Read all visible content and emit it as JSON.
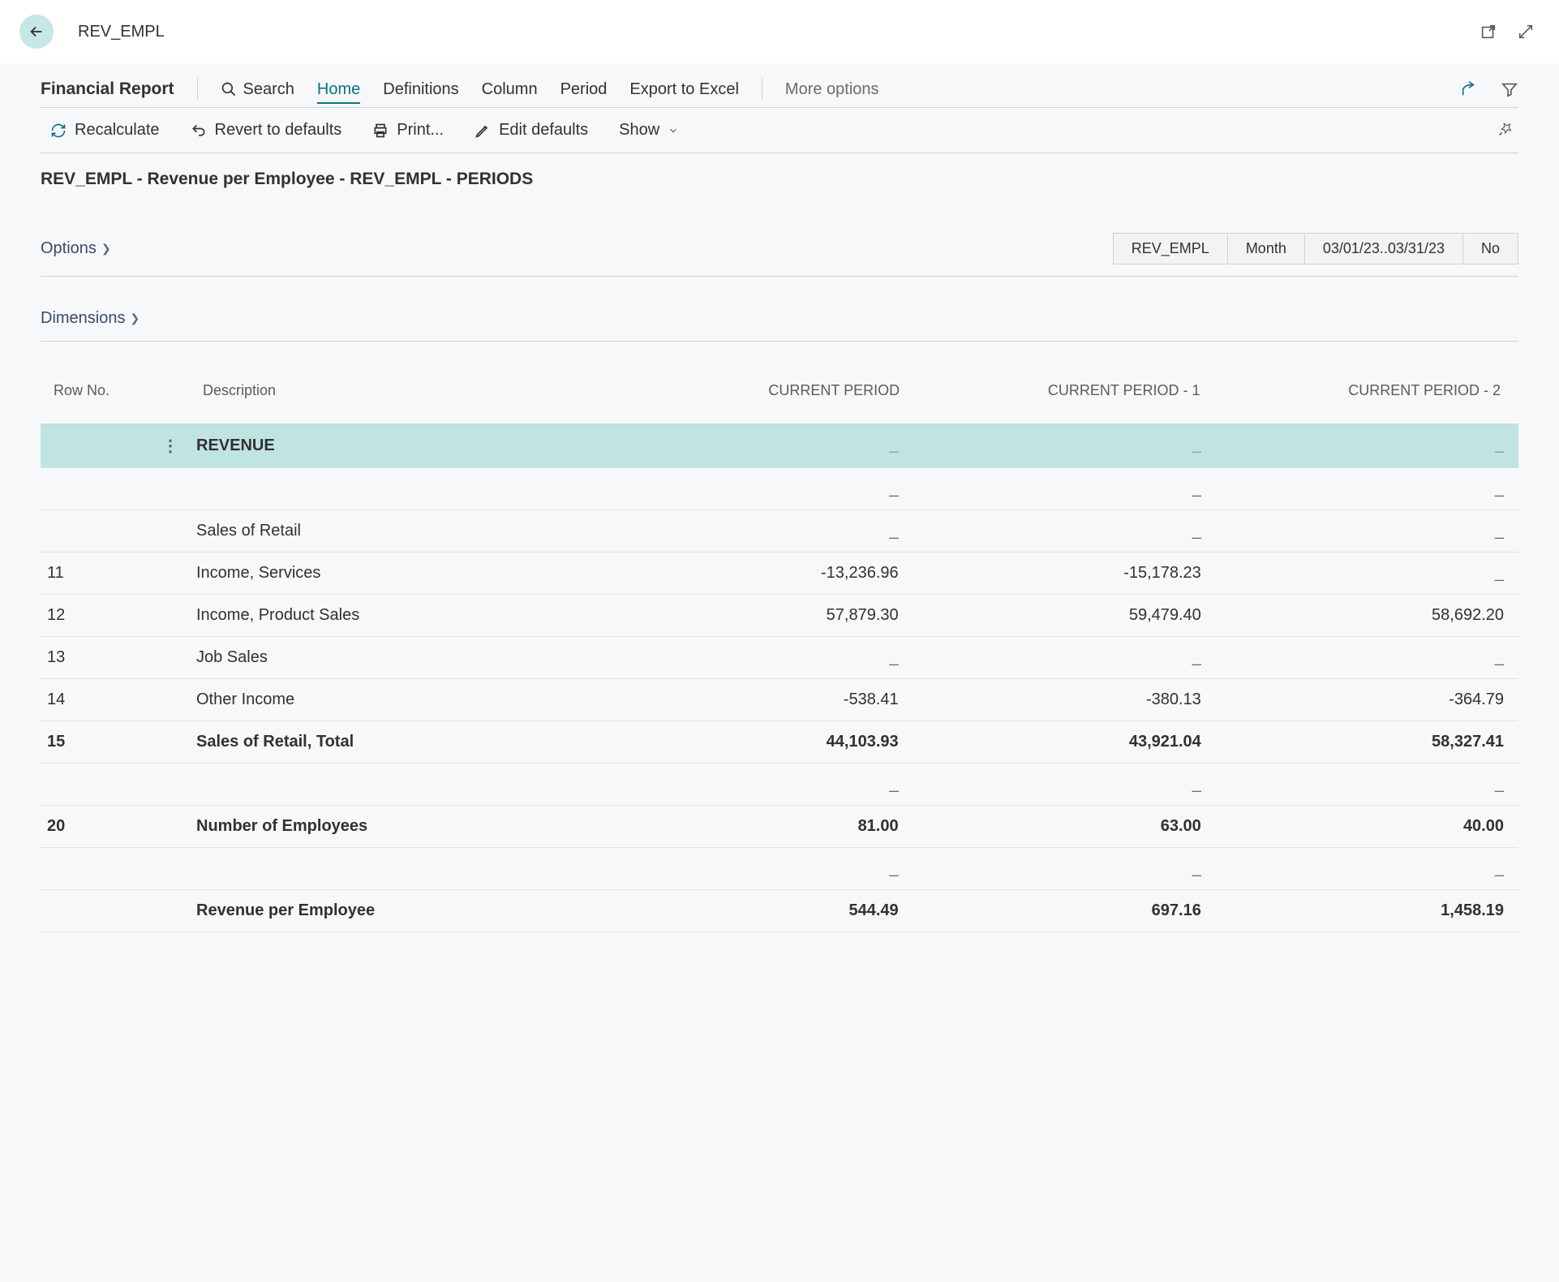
{
  "header": {
    "title": "REV_EMPL"
  },
  "ribbon": {
    "title": "Financial Report",
    "search": "Search",
    "home": "Home",
    "definitions": "Definitions",
    "column": "Column",
    "period": "Period",
    "export_excel": "Export to Excel",
    "more_options": "More options"
  },
  "toolbar": {
    "recalculate": "Recalculate",
    "revert": "Revert to defaults",
    "print": "Print...",
    "edit_defaults": "Edit defaults",
    "show": "Show"
  },
  "subtitle": "REV_EMPL - Revenue per Employee - REV_EMPL - PERIODS",
  "options_panel": {
    "label": "Options",
    "pills": [
      "REV_EMPL",
      "Month",
      "03/01/23..03/31/23",
      "No"
    ]
  },
  "dimensions_panel": {
    "label": "Dimensions"
  },
  "table": {
    "headers": {
      "row_no": "Row No.",
      "description": "Description",
      "col1": "CURRENT PERIOD",
      "col2": "CURRENT PERIOD - 1",
      "col3": "CURRENT PERIOD - 2"
    },
    "rows": [
      {
        "row_no": "",
        "desc": "REVENUE",
        "c1": "_",
        "c2": "_",
        "c3": "_",
        "bold": true,
        "hl": true,
        "menu": true
      },
      {
        "row_no": "",
        "desc": "",
        "c1": "_",
        "c2": "_",
        "c3": "_"
      },
      {
        "row_no": "",
        "desc": "Sales of Retail",
        "c1": "_",
        "c2": "_",
        "c3": "_"
      },
      {
        "row_no": "11",
        "desc": "Income, Services",
        "c1": "-13,236.96",
        "c2": "-15,178.23",
        "c3": "_"
      },
      {
        "row_no": "12",
        "desc": "Income, Product Sales",
        "c1": "57,879.30",
        "c2": "59,479.40",
        "c3": "58,692.20"
      },
      {
        "row_no": "13",
        "desc": "Job Sales",
        "c1": "_",
        "c2": "_",
        "c3": "_"
      },
      {
        "row_no": "14",
        "desc": "Other Income",
        "c1": "-538.41",
        "c2": "-380.13",
        "c3": "-364.79"
      },
      {
        "row_no": "15",
        "desc": "Sales of Retail, Total",
        "c1": "44,103.93",
        "c2": "43,921.04",
        "c3": "58,327.41",
        "bold": true
      },
      {
        "row_no": "",
        "desc": "",
        "c1": "_",
        "c2": "_",
        "c3": "_"
      },
      {
        "row_no": "20",
        "desc": "Number of Employees",
        "c1": "81.00",
        "c2": "63.00",
        "c3": "40.00",
        "bold": true
      },
      {
        "row_no": "",
        "desc": "",
        "c1": "_",
        "c2": "_",
        "c3": "_"
      },
      {
        "row_no": "",
        "desc": "Revenue per Employee",
        "c1": "544.49",
        "c2": "697.16",
        "c3": "1,458.19",
        "bold": true
      }
    ]
  }
}
